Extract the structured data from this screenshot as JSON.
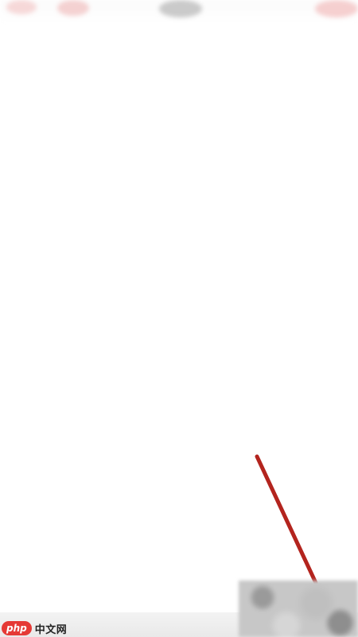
{
  "watermark": {
    "badge": "php",
    "text": "中文网"
  },
  "colors": {
    "arrow": "#b3241e",
    "logo_red": "#e53935"
  }
}
